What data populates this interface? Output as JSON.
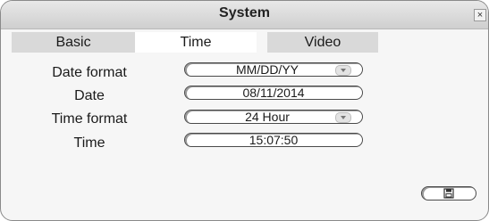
{
  "window": {
    "title": "System",
    "close_glyph": "×"
  },
  "tabs": [
    {
      "label": "Basic",
      "active": false
    },
    {
      "label": "Time",
      "active": true
    },
    {
      "label": "Video",
      "active": false
    }
  ],
  "time_settings": {
    "date_format": {
      "label": "Date format",
      "value": "MM/DD/YY"
    },
    "date": {
      "label": "Date",
      "value": "08/11/2014"
    },
    "time_format": {
      "label": "Time format",
      "value": "24 Hour"
    },
    "time": {
      "label": "Time",
      "value": "15:07:50"
    }
  },
  "footer": {
    "save_icon": "save-icon"
  }
}
